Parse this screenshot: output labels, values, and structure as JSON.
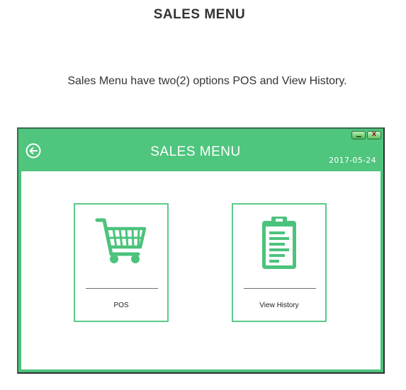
{
  "page": {
    "title": "SALES MENU",
    "description": "Sales Menu have two(2) options POS and View History."
  },
  "window": {
    "title": "SALES MENU",
    "date": "2017-05-24",
    "back_icon": "arrow-left-circle-icon",
    "controls": {
      "minimize_icon": "minimize-icon",
      "close_icon": "close-icon",
      "close_glyph": "x"
    }
  },
  "menu": {
    "items": [
      {
        "label": "POS",
        "icon": "shopping-cart-icon"
      },
      {
        "label": "View History",
        "icon": "clipboard-list-icon"
      }
    ]
  },
  "colors": {
    "accent": "#4fc57e",
    "tile_border": "#5cc98a",
    "icon": "#4cc37c",
    "text": "#333333"
  }
}
